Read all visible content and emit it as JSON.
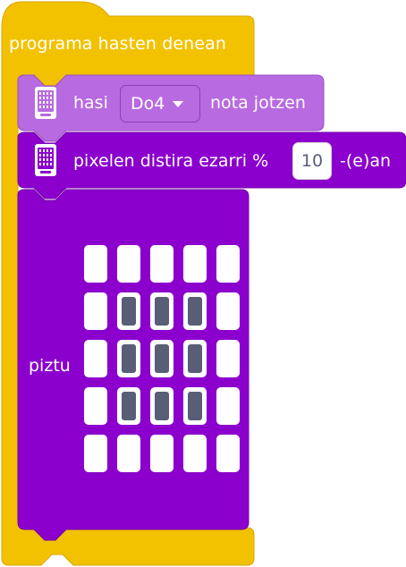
{
  "hat_block": {
    "label": "programa hasten denean",
    "color": "#F2C200"
  },
  "play_note_block": {
    "prefix": "hasi",
    "note": "Do4",
    "suffix": "nota jotzen",
    "color": "#B86AE0",
    "icon": "microbit-device-icon"
  },
  "brightness_block": {
    "prefix": "pixelen distira ezarri %",
    "value": "10",
    "suffix": "-(e)an",
    "color": "#8B00CC",
    "icon": "microbit-device-icon"
  },
  "show_block": {
    "label": "piztu",
    "color": "#8B00CC",
    "grid": [
      [
        false,
        false,
        false,
        false,
        false
      ],
      [
        false,
        true,
        true,
        true,
        false
      ],
      [
        false,
        true,
        true,
        true,
        false
      ],
      [
        false,
        true,
        true,
        true,
        false
      ],
      [
        false,
        false,
        false,
        false,
        false
      ]
    ]
  }
}
